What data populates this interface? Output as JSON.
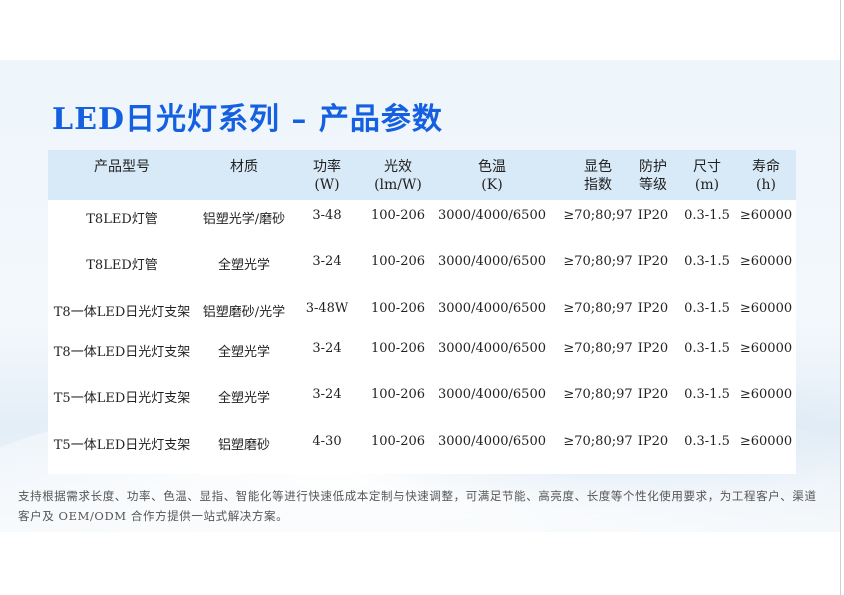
{
  "title": "LED日光灯系列 – 产品参数",
  "table": {
    "headers": [
      {
        "l1": "产品型号",
        "l2": ""
      },
      {
        "l1": "材质",
        "l2": ""
      },
      {
        "l1": "功率",
        "l2": "(W)"
      },
      {
        "l1": "光效",
        "l2": "(lm/W)"
      },
      {
        "l1": "色温",
        "l2": "(K)"
      },
      {
        "l1": "显色",
        "l2": "指数"
      },
      {
        "l1": "防护",
        "l2": "等级"
      },
      {
        "l1": "尺寸",
        "l2": "(m)"
      },
      {
        "l1": "寿命",
        "l2": "(h)"
      }
    ],
    "rows": [
      [
        "T8LED灯管",
        "铝塑光学/磨砂",
        "3-48",
        "100-206",
        "3000/4000/6500",
        "≥70;80;97",
        "IP20",
        "0.3-1.5",
        "≥60000"
      ],
      [
        "T8LED灯管",
        "全塑光学",
        "3-24",
        "100-206",
        "3000/4000/6500",
        "≥70;80;97",
        "IP20",
        "0.3-1.5",
        "≥60000"
      ],
      [
        "T8一体LED日光灯支架",
        "铝塑磨砂/光学",
        "3-48W",
        "100-206",
        "3000/4000/6500",
        "≥70;80;97",
        "IP20",
        "0.3-1.5",
        "≥60000"
      ],
      [
        "T8一体LED日光灯支架",
        "全塑光学",
        "3-24",
        "100-206",
        "3000/4000/6500",
        "≥70;80;97",
        "IP20",
        "0.3-1.5",
        "≥60000"
      ],
      [
        "T5一体LED日光灯支架",
        "全塑光学",
        "3-24",
        "100-206",
        "3000/4000/6500",
        "≥70;80;97",
        "IP20",
        "0.3-1.5",
        "≥60000"
      ],
      [
        "T5一体LED日光灯支架",
        "铝塑磨砂",
        "4-30",
        "100-206",
        "3000/4000/6500",
        "≥70;80;97",
        "IP20",
        "0.3-1.5",
        "≥60000"
      ]
    ]
  },
  "note": "支持根据需求长度、功率、色温、显指、智能化等进行快速低成本定制与快速调整，可满足节能、高亮度、长度等个性化使用要求，为工程客户、渠道客户及 OEM/ODM 合作方提供一站式解决方案。",
  "colors": {
    "title": "#1560e0",
    "header_bg": "#d8e9f7"
  }
}
